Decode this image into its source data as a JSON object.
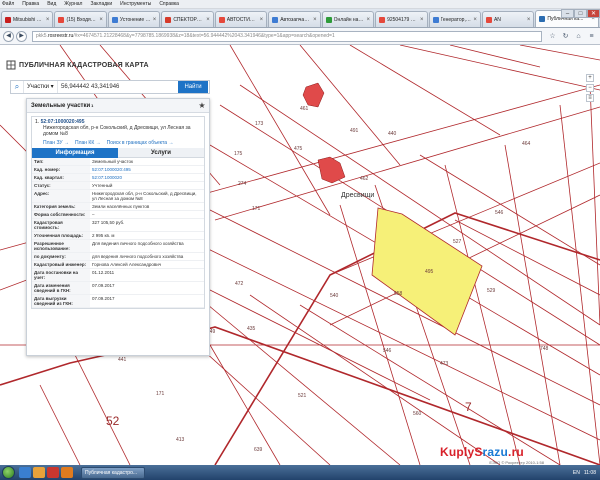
{
  "menu": [
    "Файл",
    "Правка",
    "Вид",
    "Журнал",
    "Закладки",
    "Инструменты",
    "Справка"
  ],
  "tabs": [
    {
      "label": "Mitsubishi 8(25...",
      "color": "#c81e1e"
    },
    {
      "label": "(15) Входящие",
      "color": "#e5483b"
    },
    {
      "label": "Устонение ко...",
      "color": "#3d7bd3"
    },
    {
      "label": "СПЕКТОРКИС ...",
      "color": "#d63a2a"
    },
    {
      "label": "АВТОСТИЛЬ 2...",
      "color": "#e5483b"
    },
    {
      "label": "Автозапчасти...",
      "color": "#3d7bd3"
    },
    {
      "label": "Онлайн наход...",
      "color": "#2e9b3a"
    },
    {
      "label": "92504179 РЕТ...",
      "color": "#e5483b"
    },
    {
      "label": "Генератор, а...",
      "color": "#3d7bd3"
    },
    {
      "label": "AN",
      "color": "#e5483b"
    },
    {
      "label": "Публичная ка...",
      "color": "#2b6cb0",
      "active": true
    }
  ],
  "address": {
    "prefix": "pkk5.",
    "host": "rosreestr.ru",
    "rest": "/#x=4674571.21228468&y=7798785.1869938&z=18&text=56.944442%2043.341946&type=1&app=search&opened=1"
  },
  "app": {
    "title": "ПУБЛИЧНАЯ КАДАСТРОВАЯ КАРТА"
  },
  "search": {
    "category": "Участки",
    "query": "56,944442 43,341946",
    "button": "Найти"
  },
  "panel": {
    "title": "Земельные участки",
    "count": "1",
    "card": {
      "index": "1.",
      "number": "52:07:1000020:495",
      "address": "Нижегородская обл, р-н Сокольский, д Дресвищи, ул Лесная за домом №8",
      "links": [
        "План ЗУ →",
        "План КК →",
        "Поиск в границах объекта →"
      ],
      "tab_info": "Информация",
      "tab_services": "Услуги"
    },
    "rows": [
      {
        "k": "Тип:",
        "v": "Земельный участок",
        "link": false
      },
      {
        "k": "Кад. номер:",
        "v": "52:07:1000020:495",
        "link": true
      },
      {
        "k": "Кад. квартал:",
        "v": "52:07:1000020",
        "link": true
      },
      {
        "k": "Статус:",
        "v": "Учтенный",
        "link": false
      },
      {
        "k": "Адрес:",
        "v": "Нижегородская обл, р-н Сокольский, д Дресвищи, ул Лесная за домом №8",
        "link": false
      },
      {
        "k": "Категория земель:",
        "v": "Земли населённых пунктов",
        "link": false
      },
      {
        "k": "Форма собственности:",
        "v": "–",
        "link": false
      },
      {
        "k": "Кадастровая стоимость:",
        "v": "327 105,50 руб.",
        "link": false
      },
      {
        "k": "Уточненная площадь:",
        "v": "2 995 кв. м",
        "link": false
      },
      {
        "k": "Разрешенное использование:",
        "v": "Для ведения личного подсобного хозяйства",
        "link": false
      },
      {
        "k": "по документу:",
        "v": "для ведения личного подсобного хозяйства",
        "link": false
      },
      {
        "k": "Кадастровый инженер:",
        "v": "Горнова Алексей Александрович",
        "link": false
      },
      {
        "k": "Дата постановки на учет:",
        "v": "01.12.2011",
        "link": false
      },
      {
        "k": "Дата изменения сведений в ГКН:",
        "v": "07.09.2017",
        "link": false
      },
      {
        "k": "Дата выгрузки сведений из ГКН:",
        "v": "07.09.2017",
        "link": false
      }
    ]
  },
  "map": {
    "village": "Дресвищи",
    "big_labels": [
      "52",
      "7"
    ],
    "parcel_labels": [
      "173",
      "475",
      "440",
      "461",
      "462",
      "464",
      "527",
      "558",
      "540",
      "175",
      "274",
      "491",
      "546",
      "529",
      "472",
      "545",
      "171",
      "449",
      "435",
      "171",
      "441",
      "521",
      "639",
      "560",
      "748",
      "546",
      "473",
      "413"
    ],
    "selected_label": "495",
    "colors": {
      "line": "#b0282c",
      "selected_fill": "#f6f078",
      "building": "#e04a4a"
    }
  },
  "attribution": "ЕЭКО © Росреестр 2010-1:58",
  "taskbar": {
    "task": "Публичная кадастро...",
    "lang": "EN",
    "time": "11:08"
  },
  "watermark": {
    "red": "KuplyS",
    "blue": "razu",
    "red2": ".ru"
  }
}
